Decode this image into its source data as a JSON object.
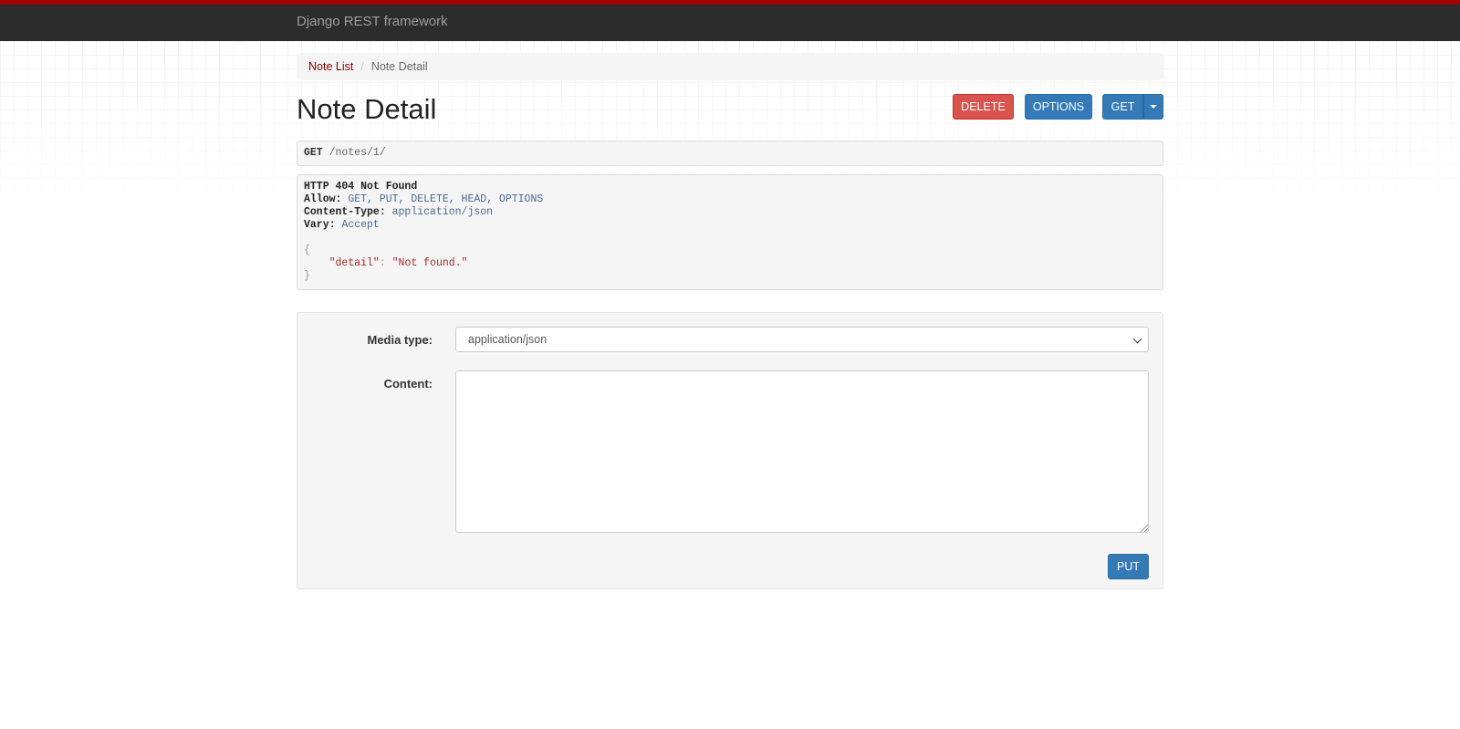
{
  "navbar": {
    "brand": "Django REST framework"
  },
  "breadcrumb": {
    "items": [
      {
        "label": "Note List"
      },
      {
        "label": "Note Detail"
      }
    ],
    "separator": "/"
  },
  "page": {
    "title": "Note Detail"
  },
  "actions": {
    "delete_label": "DELETE",
    "options_label": "OPTIONS",
    "get_label": "GET"
  },
  "request": {
    "method": "GET",
    "path": "/notes/1/"
  },
  "response": {
    "status_line": "HTTP 404 Not Found",
    "headers": [
      {
        "name": "Allow:",
        "value": "GET, PUT, DELETE, HEAD, OPTIONS"
      },
      {
        "name": "Content-Type:",
        "value": "application/json"
      },
      {
        "name": "Vary:",
        "value": "Accept"
      }
    ],
    "body": {
      "open_brace": "{",
      "key": "\"detail\"",
      "colon": ": ",
      "value": "\"Not found.\"",
      "close_brace": "}"
    }
  },
  "form": {
    "media_type_label": "Media type:",
    "media_type_value": "application/json",
    "content_label": "Content:",
    "content_value": "",
    "submit_label": "PUT"
  },
  "colors": {
    "brand_red": "#a30000",
    "navbar_bg": "#2c2c2c",
    "primary": "#337ab7",
    "danger": "#d9534f",
    "link": "#8b0000"
  }
}
